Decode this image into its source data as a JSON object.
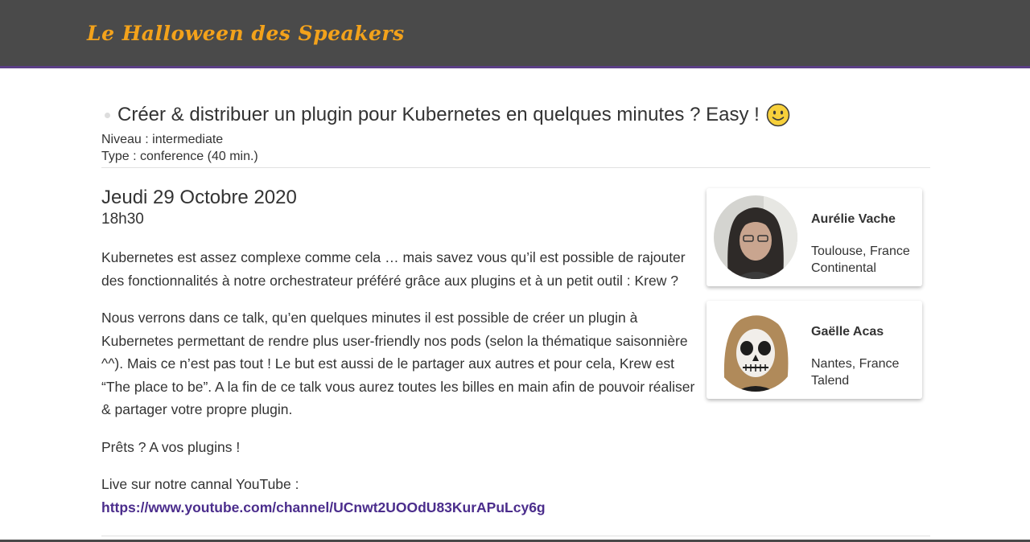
{
  "header": {
    "logo_text": "Le Halloween des Speakers",
    "bar_color": "#4a4a4a",
    "accent_color": "#5b3f86",
    "logo_color": "#f3a21b"
  },
  "talk": {
    "title": "Créer & distribuer un plugin pour Kubernetes en quelques minutes ? Easy !",
    "title_emoji_icon": "smiley-icon",
    "level": "Niveau : intermediate",
    "type": "Type : conference (40 min.)",
    "date": "Jeudi 29 Octobre 2020",
    "time": "18h30",
    "paragraphs": [
      "Kubernetes est assez complexe comme cela … mais savez vous qu’il est possible de rajouter des fonctionnalités à notre orchestrateur préféré grâce aux plugins et à un petit outil : Krew ?",
      "Nous verrons dans ce talk, qu’en quelques minutes il est possible de créer un plugin à Kubernetes permettant de rendre plus user-friendly nos pods (selon la thématique saisonnière ^^). Mais ce n’est pas tout ! Le but est aussi de le partager aux autres et pour cela, Krew est “The place to be”. A la fin de ce talk vous aurez toutes les billes en main afin de pouvoir réaliser & partager votre propre plugin.",
      "Prêts ? A vos plugins !"
    ],
    "live_label": "Live sur notre cannal YouTube : ",
    "live_link": "https://www.youtube.com/channel/UCnwt2UOOdU83KurAPuLcy6g",
    "link_color": "#4b2d8c"
  },
  "speakers": [
    {
      "name": "Aurélie Vache",
      "location": "Toulouse, France",
      "company": "Continental"
    },
    {
      "name": "Gaëlle Acas",
      "location": "Nantes, France",
      "company": "Talend"
    }
  ]
}
